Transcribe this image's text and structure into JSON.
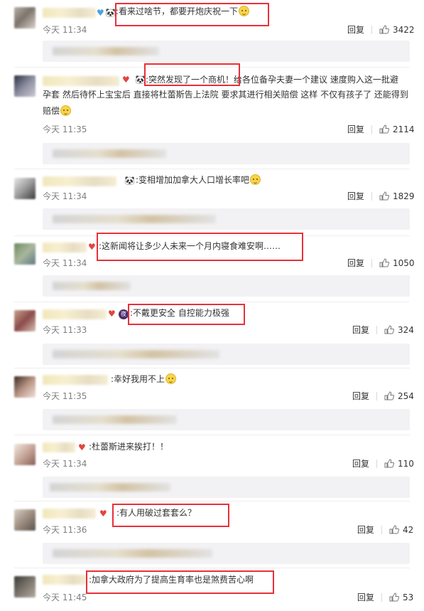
{
  "reply_label": "回复",
  "comments": [
    {
      "time": "今天 11:34",
      "text": "看来过啥节，都要开炮庆祝一下",
      "likes": "3422",
      "badges": [
        "heart-badge",
        "panda-badge"
      ]
    },
    {
      "time": "今天 11:35",
      "text_line1": "突然发现了一个商机！给各位备孕夫妻一个建议 速度购入这一批避",
      "text_line2": "孕套 然后待怀上宝宝后 直接将杜蕾斯告上法院 要求其进行相关赔偿 这样 不仅有孩子了 还能得到",
      "text_line3": "赔偿",
      "likes": "2114",
      "badges": [
        "vip-badge",
        "panda-badge"
      ]
    },
    {
      "time": "今天 11:34",
      "text": "变相增加加拿大人口增长率吧",
      "likes": "1829",
      "badges": [
        "panda-badge"
      ]
    },
    {
      "time": "今天 11:34",
      "text": "这新闻将让多少人未来一个月内寝食难安啊……",
      "likes": "1050",
      "badges": [
        "vip-badge"
      ]
    },
    {
      "time": "今天 11:33",
      "text": "不戴更安全 自控能力极强",
      "likes": "324",
      "badges": [
        "night-badge"
      ]
    },
    {
      "time": "今天 11:35",
      "text": "幸好我用不上",
      "likes": "254",
      "badges": []
    },
    {
      "time": "今天 11:34",
      "text": "杜蕾斯进来挨打！！",
      "likes": "110",
      "badges": [
        "vip-badge"
      ]
    },
    {
      "time": "今天 11:36",
      "text": "有人用破过套套么？",
      "likes": "42",
      "badges": [
        "vip-badge"
      ]
    },
    {
      "time": "今天 11:45",
      "text": "加拿大政府为了提高生育率也是煞费苦心啊",
      "likes": "53",
      "badges": []
    }
  ],
  "colors": {
    "highlight_box": "#e8303a",
    "preview_bg": "#f2f2f5",
    "time_text": "#808080"
  },
  "icons": {
    "like": "thumbs-up-icon",
    "emoji": "smirk-face-emoji-icon"
  }
}
